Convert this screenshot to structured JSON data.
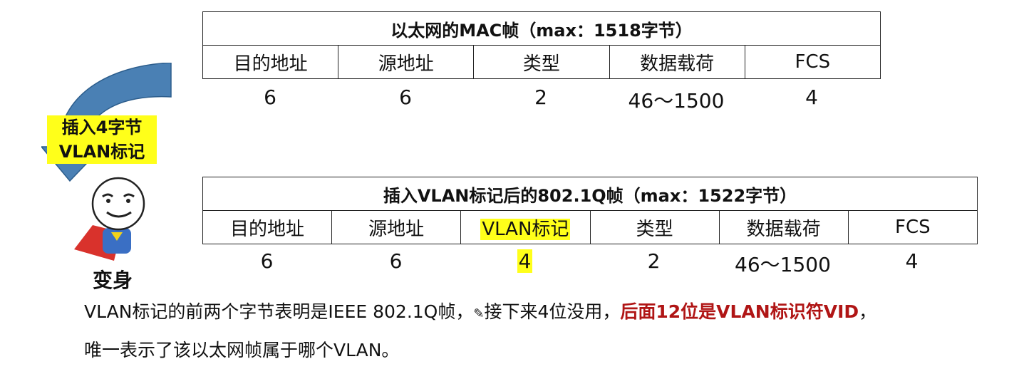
{
  "mac_frame": {
    "title": "以太网的MAC帧（max：1518字节）",
    "fields": [
      "目的地址",
      "源地址",
      "类型",
      "数据载荷",
      "FCS"
    ],
    "sizes": [
      "6",
      "6",
      "2",
      "46～1500",
      "4"
    ]
  },
  "vlan_frame": {
    "title": "插入VLAN标记后的802.1Q帧（max：1522字节）",
    "fields": [
      "目的地址",
      "源地址",
      "VLAN标记",
      "类型",
      "数据载荷",
      "FCS"
    ],
    "sizes": [
      "6",
      "6",
      "4",
      "2",
      "46～1500",
      "4"
    ]
  },
  "insert_note": {
    "line1": "插入4字节",
    "line2": "VLAN标记"
  },
  "mascot_caption": "变身",
  "explanation": {
    "part1": "VLAN标记的前两个字节表明是IEEE 802.1Q帧，",
    "part2": "接下来4位没用，",
    "part3_red": "后面12位是VLAN标识符VID",
    "part4": "，",
    "line2": "唯一表示了该以太网帧属于哪个VLAN。"
  },
  "colors": {
    "highlight": "#ffff1a",
    "arrow": "#4a80b4",
    "emphasis": "#b01515"
  }
}
